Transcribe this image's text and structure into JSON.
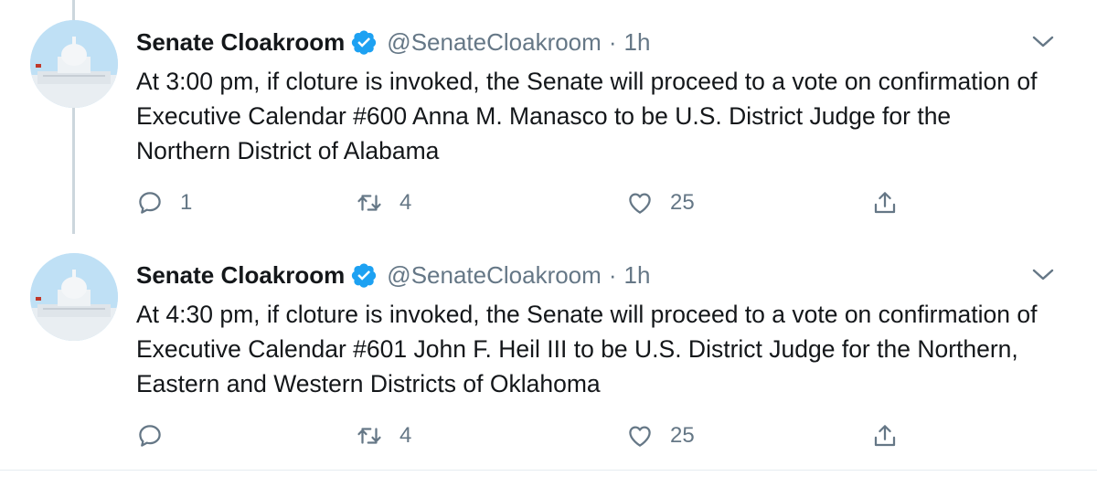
{
  "colors": {
    "text": "#14171a",
    "secondary": "#657786",
    "verified": "#1da1f2",
    "thread_line": "#ccd6dd"
  },
  "tweets": [
    {
      "name": "Senate Cloakroom",
      "handle": "@SenateCloakroom",
      "separator": "·",
      "time": "1h",
      "text": "At 3:00 pm, if cloture is invoked, the Senate will proceed to a vote on confirmation of Executive Calendar #600 Anna M. Manasco to be U.S. District Judge for the Northern District of Alabama",
      "replies": "1",
      "retweets": "4",
      "likes": "25"
    },
    {
      "name": "Senate Cloakroom",
      "handle": "@SenateCloakroom",
      "separator": "·",
      "time": "1h",
      "text": "At 4:30 pm, if cloture is invoked, the Senate will proceed to a vote on confirmation of Executive Calendar #601 John F. Heil III to be U.S. District Judge for the Northern, Eastern and Western Districts of Oklahoma",
      "replies": "",
      "retweets": "4",
      "likes": "25"
    }
  ]
}
